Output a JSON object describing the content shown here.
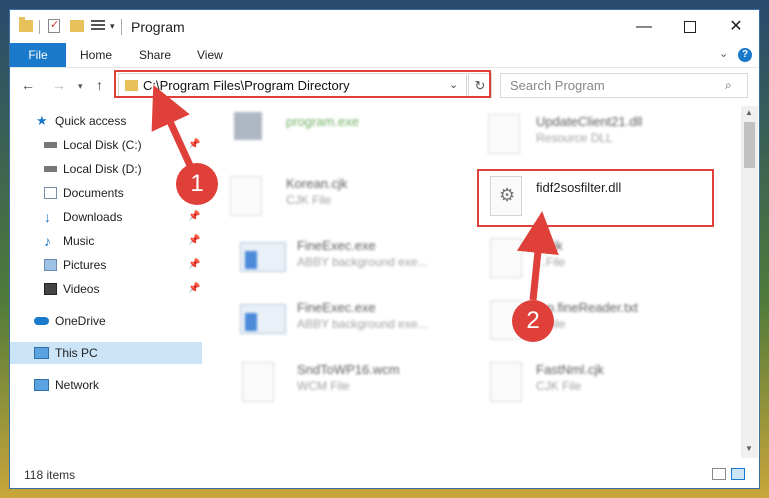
{
  "window": {
    "title": "Program",
    "minimize_label": "—",
    "maximize_label": "",
    "close_label": "✕"
  },
  "ribbon": {
    "tabs": [
      "File",
      "Home",
      "Share",
      "View"
    ],
    "help_label": "?"
  },
  "address": {
    "path": "C:\\Program Files\\Program Directory",
    "refresh_icon": "↻"
  },
  "search": {
    "placeholder": "Search Program",
    "icon": "⌕"
  },
  "sidebar": {
    "items": [
      {
        "label": "Quick access",
        "icon": "star-icon"
      },
      {
        "label": "Local Disk (C:)",
        "icon": "drive-icon",
        "pinned": true
      },
      {
        "label": "Local Disk (D:)",
        "icon": "drive-icon"
      },
      {
        "label": "Documents",
        "icon": "documents-icon",
        "pinned": true
      },
      {
        "label": "Downloads",
        "icon": "download-icon",
        "pinned": true
      },
      {
        "label": "Music",
        "icon": "music-icon",
        "pinned": true
      },
      {
        "label": "Pictures",
        "icon": "pictures-icon",
        "pinned": true
      },
      {
        "label": "Videos",
        "icon": "videos-icon",
        "pinned": true
      },
      {
        "label": "OneDrive",
        "icon": "cloud-icon"
      },
      {
        "label": "This PC",
        "icon": "computer-icon",
        "selected": true
      },
      {
        "label": "Network",
        "icon": "network-icon"
      }
    ]
  },
  "files": {
    "left": [
      {
        "name": "program.exe",
        "type": ""
      },
      {
        "name": "Korean.cjk",
        "type": "CJK File"
      },
      {
        "name": "FineExec.exe",
        "type": "ABBY background exe..."
      },
      {
        "name": "FineExec.exe",
        "type": "ABBY background exe..."
      },
      {
        "name": "SndToWP16.wcm",
        "type": "WCM File"
      }
    ],
    "right": [
      {
        "name": "UpdateClient21.dll",
        "type": "Resource DLL"
      },
      {
        "name": "fidf2sosfilter.dll",
        "type": ""
      },
      {
        "name": "...cjk",
        "type": "...File"
      },
      {
        "name": "...p.fineReader.txt",
        "type": "...File"
      },
      {
        "name": "FastNml.cjk",
        "type": "CJK File"
      }
    ]
  },
  "status": {
    "item_count": "118 items"
  },
  "annotations": {
    "callout_1": "1",
    "callout_2": "2",
    "color": "#e0403a"
  }
}
